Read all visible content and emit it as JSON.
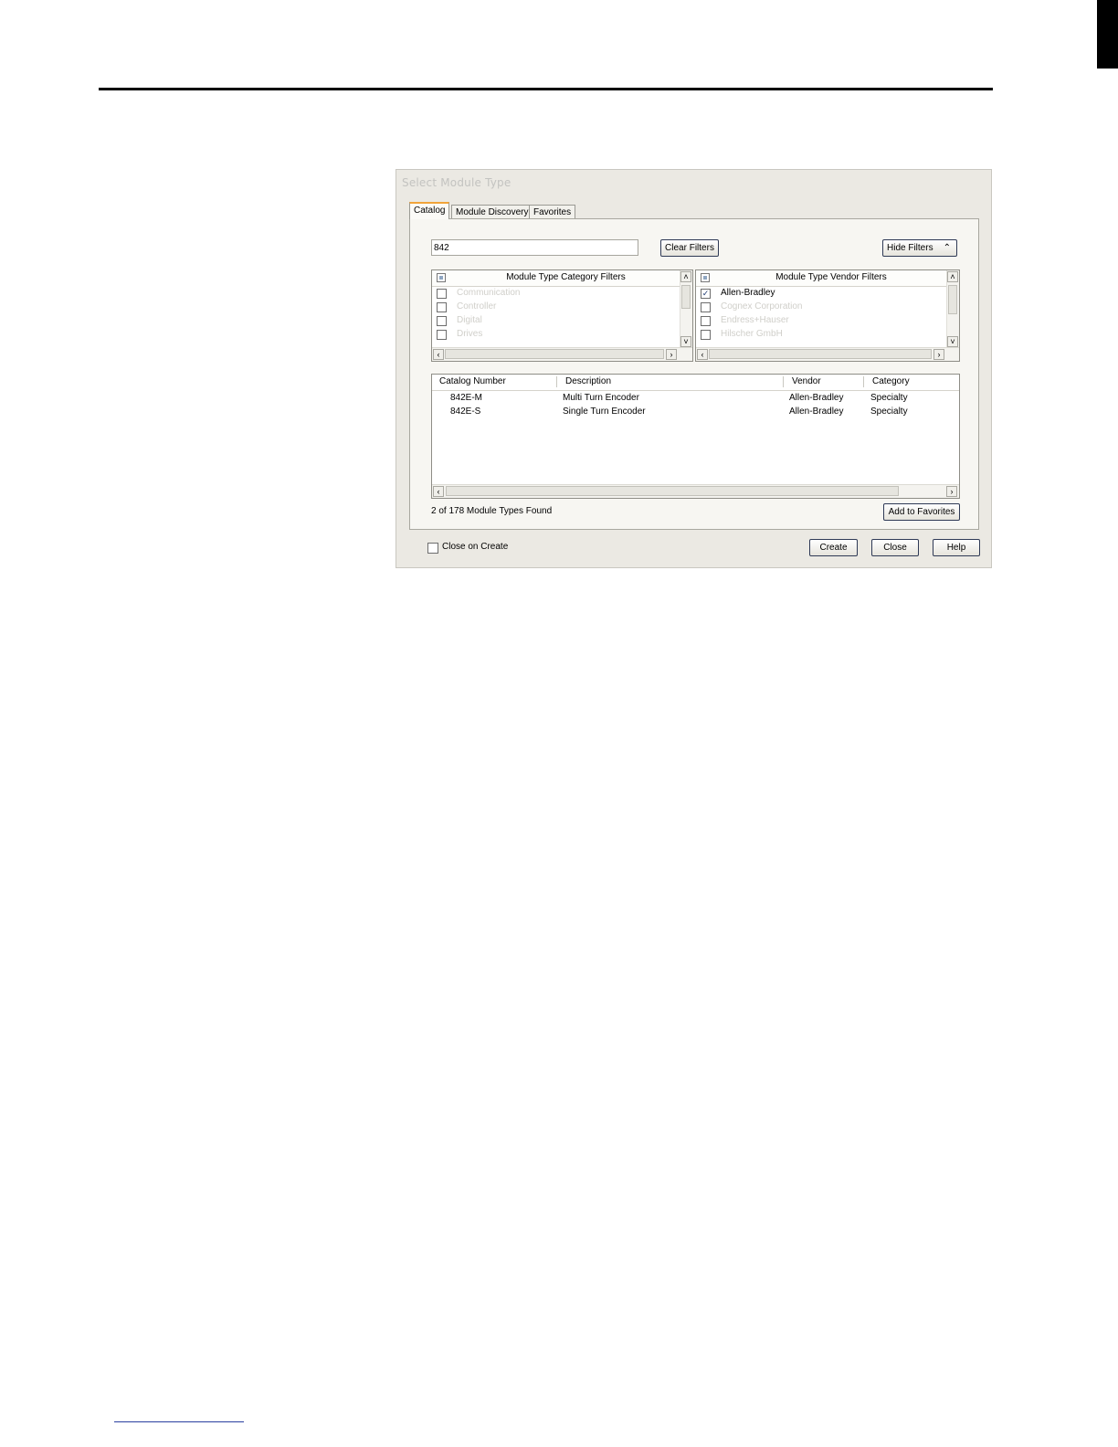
{
  "dialog": {
    "title": "Select Module Type",
    "tabs": [
      "Catalog",
      "Module Discovery",
      "Favorites"
    ],
    "search": {
      "value": "842"
    },
    "clear_filters_label": "Clear Filters",
    "hide_filters_label": "Hide Filters",
    "hide_filters_icon": "double-chevron-up-icon",
    "category_filters": {
      "header": "Module Type Category Filters",
      "items": [
        {
          "label": "Communication",
          "checked": false
        },
        {
          "label": "Controller",
          "checked": false
        },
        {
          "label": "Digital",
          "checked": false
        },
        {
          "label": "Drives",
          "checked": false
        }
      ]
    },
    "vendor_filters": {
      "header": "Module Type Vendor Filters",
      "items": [
        {
          "label": "Allen-Bradley",
          "checked": true
        },
        {
          "label": "Cognex Corporation",
          "checked": false
        },
        {
          "label": "Endress+Hauser",
          "checked": false
        },
        {
          "label": "Hilscher GmbH",
          "checked": false
        }
      ]
    },
    "results": {
      "columns": [
        "Catalog Number",
        "Description",
        "Vendor",
        "Category"
      ],
      "rows": [
        {
          "catalog": "842E-M",
          "description": "Multi Turn Encoder",
          "vendor": "Allen-Bradley",
          "category": "Specialty"
        },
        {
          "catalog": "842E-S",
          "description": "Single Turn Encoder",
          "vendor": "Allen-Bradley",
          "category": "Specialty"
        }
      ]
    },
    "status": "2  of 178 Module Types Found",
    "add_to_favorites_label": "Add to Favorites",
    "close_on_create": {
      "label": "Close on Create",
      "checked": false
    },
    "buttons": {
      "create": "Create",
      "close": "Close",
      "help": "Help"
    },
    "colors": {
      "active_tab_accent": "#f1a43a",
      "dialog_bg": "#ebe9e3",
      "panel_bg": "#f7f6f2"
    }
  }
}
